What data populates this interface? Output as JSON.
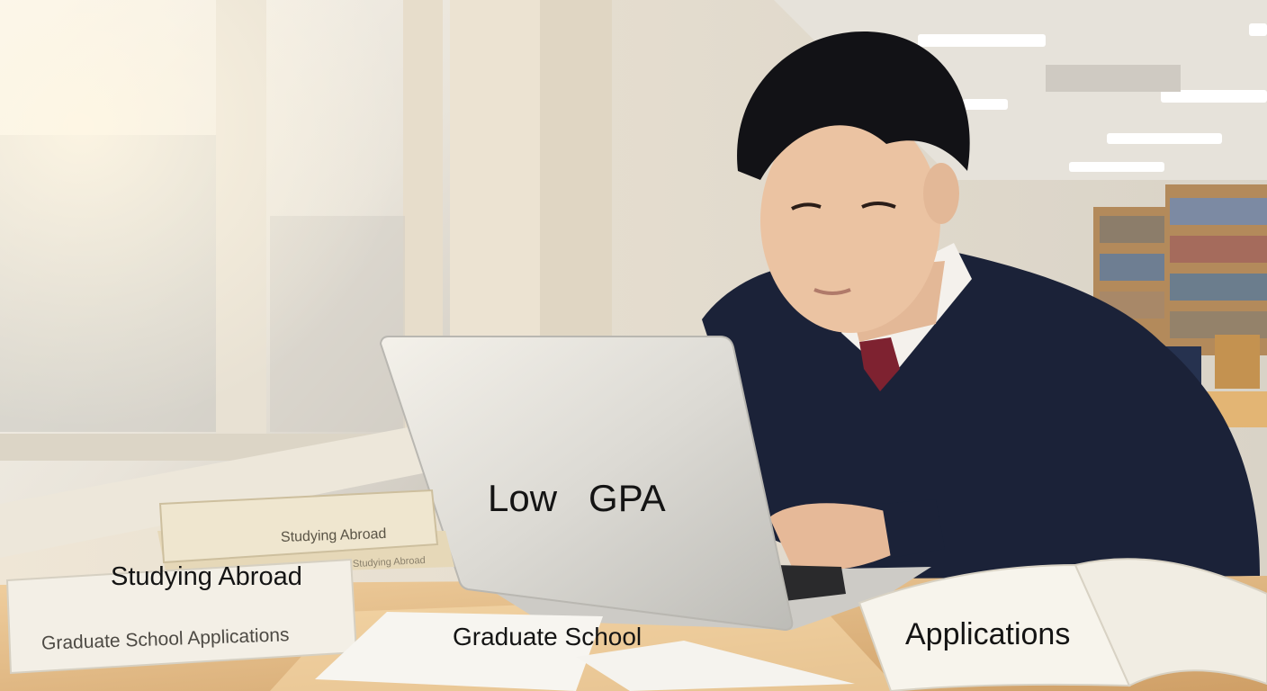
{
  "overlay_labels": {
    "laptop_screen": "Low   GPA",
    "book_stack": "Studying Abroad",
    "paper": "Graduate School",
    "open_book": "Applications"
  },
  "book_spines": {
    "top_book": "Studying Abroad",
    "middle_book": "Studying Abroad",
    "bottom_book": "Graduate School Applications"
  },
  "colors": {
    "window_light": "#f4eee2",
    "sweater": "#1b2238",
    "table": "#e2b77f",
    "laptop": "#d9d9d6",
    "book_cover": "#efe6cf"
  }
}
